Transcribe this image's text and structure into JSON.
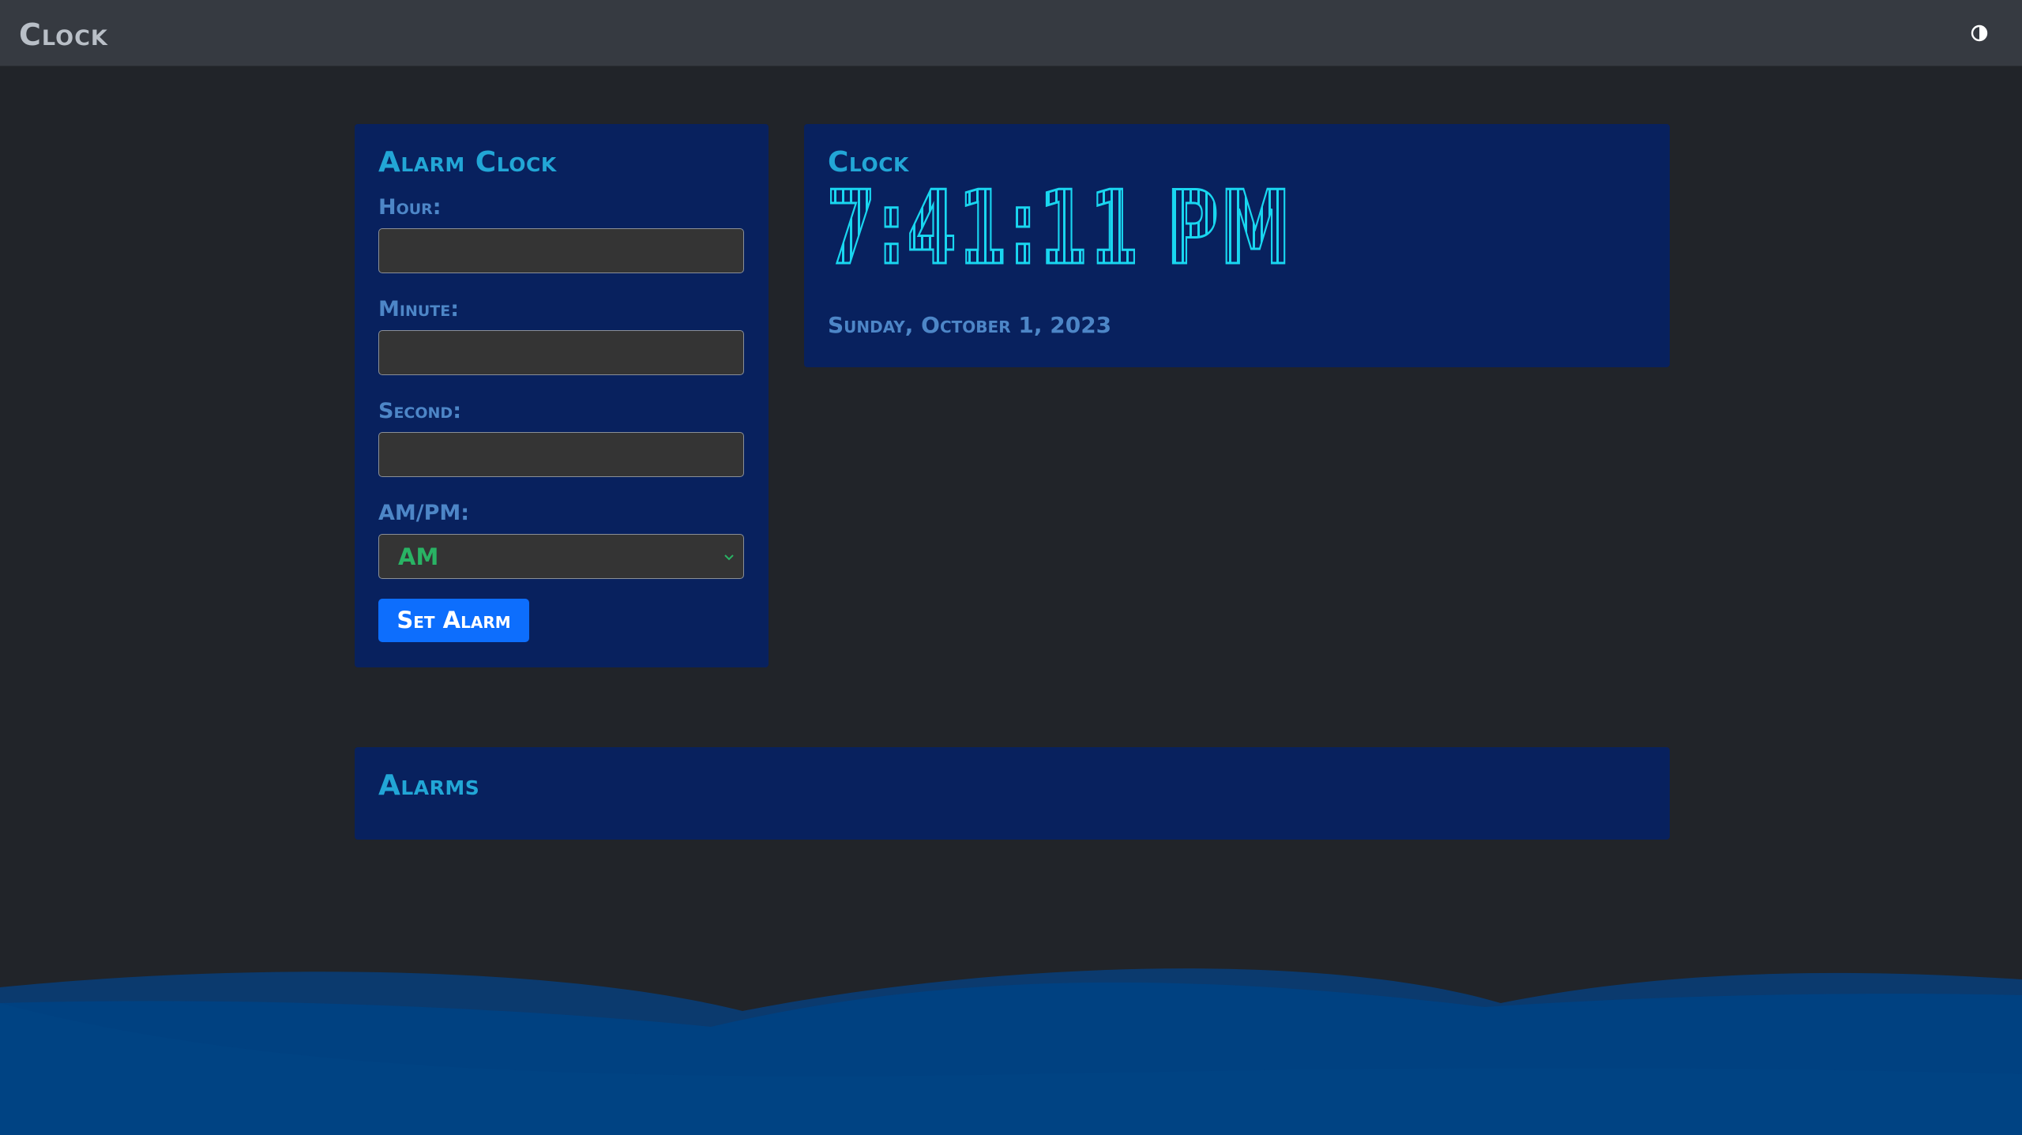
{
  "navbar": {
    "brand": "Clock",
    "theme_toggle_icon": "contrast-icon"
  },
  "alarm_form": {
    "title": "Alarm Clock",
    "hour_label": "Hour:",
    "hour_value": "",
    "minute_label": "Minute:",
    "minute_value": "",
    "second_label": "Second:",
    "second_value": "",
    "ampm_label": "AM/PM:",
    "ampm_selected": "AM",
    "submit_label": "Set Alarm"
  },
  "clock": {
    "title": "Clock",
    "time": "7:41:11 PM",
    "date": "Sunday, October 1, 2023"
  },
  "alarms": {
    "title": "Alarms",
    "items": []
  },
  "colors": {
    "background": "#212429",
    "navbar": "#363a41",
    "card": "#08215e",
    "title": "#22a6d6",
    "label": "#4d86c7",
    "clock_digits": "#19d6f0",
    "button": "#0d6efd",
    "select_text": "#29b364",
    "wave": "#004181"
  }
}
